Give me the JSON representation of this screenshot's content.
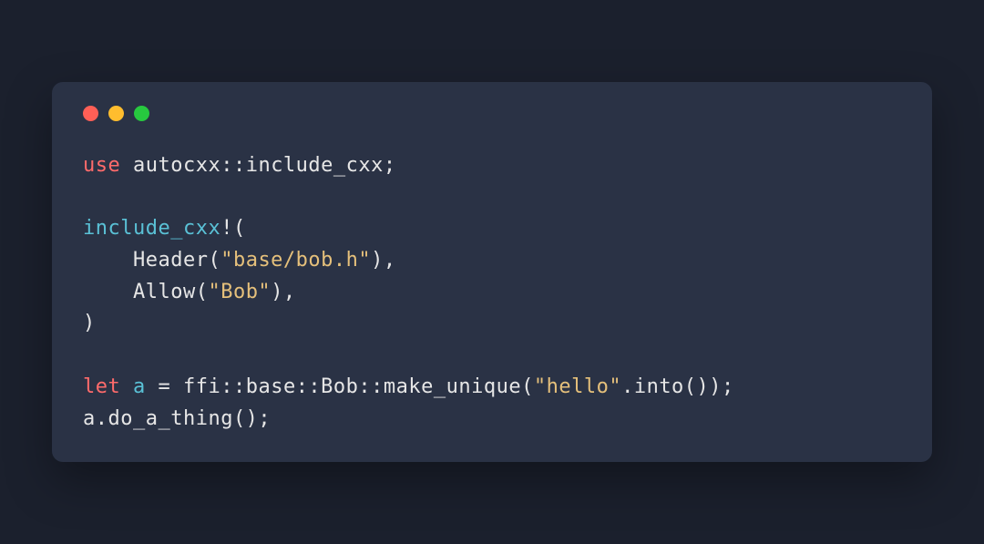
{
  "code": {
    "line1": {
      "use_kw": "use",
      "rest": " autocxx::include_cxx;"
    },
    "line3": {
      "fn_name": "include_cxx",
      "bang_paren": "!("
    },
    "line4": {
      "indent_call": "    Header(",
      "str": "\"base/bob.h\"",
      "after": "),"
    },
    "line5": {
      "indent_call": "    Allow(",
      "str": "\"Bob\"",
      "after": "),"
    },
    "line6": {
      "close": ")"
    },
    "line8": {
      "let_kw": "let",
      "space1": " ",
      "var": "a",
      "eq_and_path": " = ffi::base::Bob::make_unique(",
      "str": "\"hello\"",
      "after": ".into());"
    },
    "line9": {
      "text": "a.do_a_thing();"
    }
  }
}
